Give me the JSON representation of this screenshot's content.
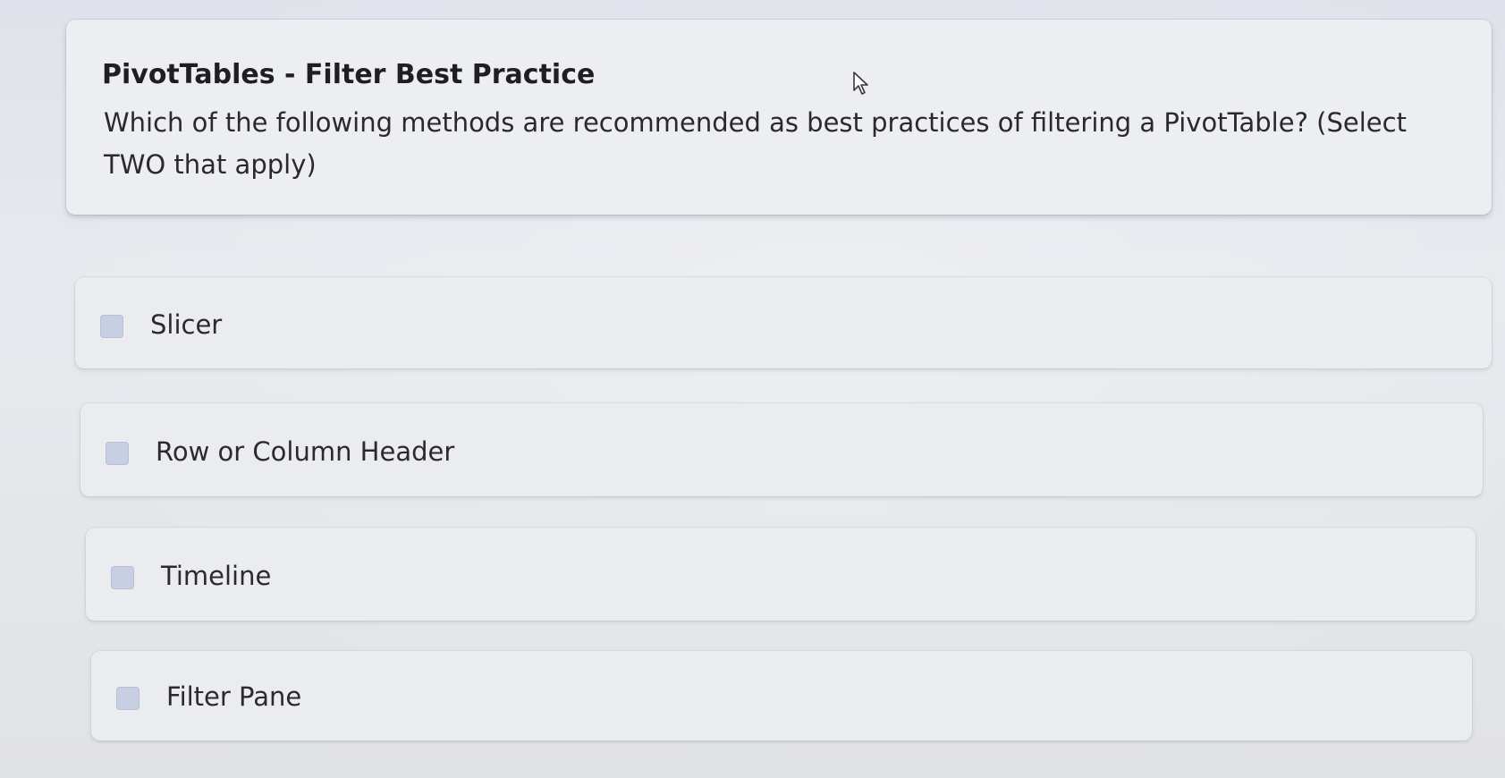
{
  "question": {
    "title": "PivotTables - Filter Best Practice",
    "text": "Which of the following methods are recommended as best practices of filtering a PivotTable? (Select TWO that apply)"
  },
  "options": [
    {
      "label": "Slicer",
      "checked": false
    },
    {
      "label": "Row or Column Header",
      "checked": false
    },
    {
      "label": "Timeline",
      "checked": false
    },
    {
      "label": "Filter Pane",
      "checked": false
    }
  ],
  "icons": {
    "cursor": "mouse-pointer-icon",
    "checkbox": "checkbox-icon"
  },
  "colors": {
    "checkbox_fill": "#c9cfe2",
    "card_background": "#eceef2"
  }
}
